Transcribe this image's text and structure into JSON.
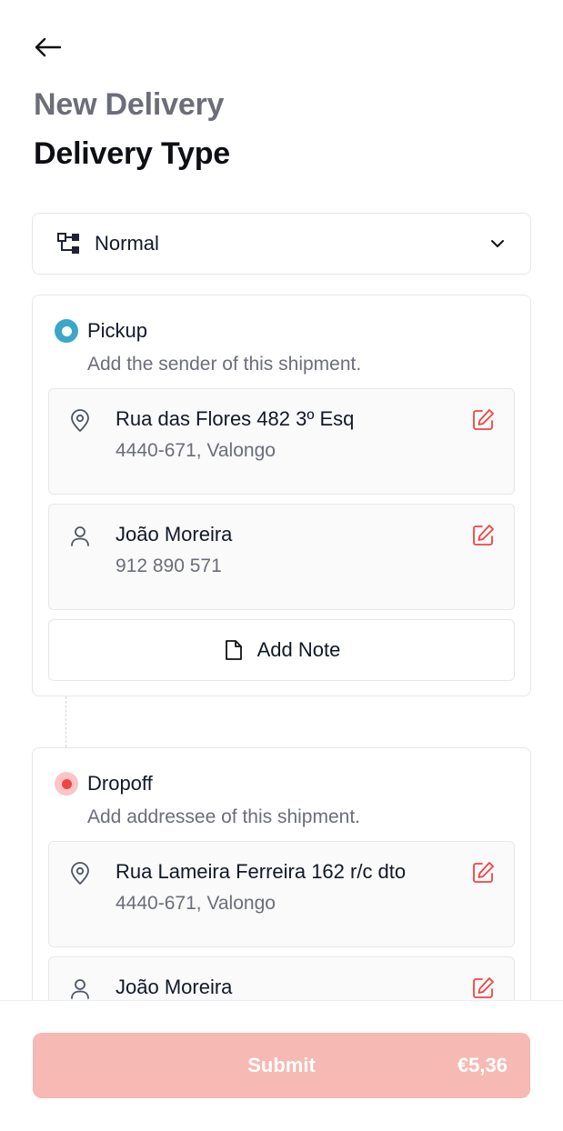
{
  "header": {
    "back_icon": "arrow-left-icon",
    "subtitle": "New Delivery",
    "title": "Delivery Type"
  },
  "delivery_type": {
    "icon": "flow-nodes-icon",
    "selected": "Normal",
    "chevron_icon": "chevron-down-icon"
  },
  "pickup": {
    "label": "Pickup",
    "description": "Add the sender of this shipment.",
    "address": {
      "icon": "map-pin-icon",
      "line1": "Rua das Flores 482 3º Esq",
      "line2": "4440-671, Valongo"
    },
    "contact": {
      "icon": "user-icon",
      "name": "João Moreira",
      "phone": "912 890 571"
    },
    "note": {
      "icon": "file-icon",
      "label": "Add Note"
    }
  },
  "dropoff": {
    "label": "Dropoff",
    "description": "Add addressee of this shipment.",
    "address": {
      "icon": "map-pin-icon",
      "line1": "Rua Lameira Ferreira 162 r/c dto",
      "line2": "4440-671, Valongo"
    },
    "contact": {
      "icon": "user-icon",
      "name": "João Moreira",
      "phone": ""
    }
  },
  "footer": {
    "submit_label": "Submit",
    "price": "€5,36"
  },
  "colors": {
    "pickup_accent": "#3aa7c9",
    "dropoff_accent": "#ef4444",
    "edit_icon": "#ef4444",
    "submit_bg": "#f6b9b3"
  }
}
